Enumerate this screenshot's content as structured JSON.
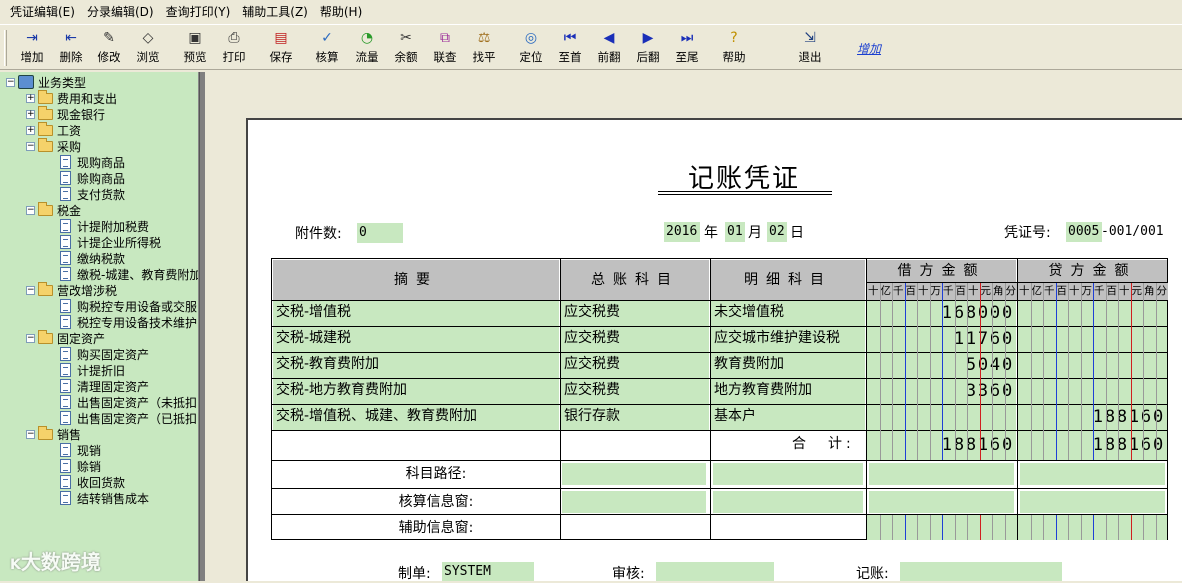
{
  "menu": [
    "凭证编辑(E)",
    "分录编辑(D)",
    "查询打印(Y)",
    "辅助工具(Z)",
    "帮助(H)"
  ],
  "toolbar": {
    "buttons": [
      {
        "label": "增加",
        "icon": "add-icon"
      },
      {
        "label": "删除",
        "icon": "delete-icon"
      },
      {
        "label": "修改",
        "icon": "edit-icon"
      },
      {
        "label": "浏览",
        "icon": "browse-icon"
      },
      {
        "label": "预览",
        "icon": "preview-icon"
      },
      {
        "label": "打印",
        "icon": "printer-icon"
      },
      {
        "label": "保存",
        "icon": "save-icon"
      },
      {
        "label": "核算",
        "icon": "audit-icon"
      },
      {
        "label": "流量",
        "icon": "flow-icon"
      },
      {
        "label": "余额",
        "icon": "balance-icon"
      },
      {
        "label": "联查",
        "icon": "link-query-icon"
      },
      {
        "label": "找平",
        "icon": "scale-icon"
      },
      {
        "label": "定位",
        "icon": "locate-icon"
      },
      {
        "label": "至首",
        "icon": "first-icon"
      },
      {
        "label": "前翻",
        "icon": "prev-icon"
      },
      {
        "label": "后翻",
        "icon": "next-icon"
      },
      {
        "label": "至尾",
        "icon": "last-icon"
      },
      {
        "label": "帮助",
        "icon": "help-icon"
      },
      {
        "label": "退出",
        "icon": "exit-icon"
      }
    ],
    "link": "增加"
  },
  "tree": {
    "root": "业务类型",
    "nodes": [
      {
        "label": "费用和支出",
        "type": "folder",
        "level": 1,
        "exp": "+"
      },
      {
        "label": "现金银行",
        "type": "folder",
        "level": 1,
        "exp": "+"
      },
      {
        "label": "工资",
        "type": "folder",
        "level": 1,
        "exp": "+"
      },
      {
        "label": "采购",
        "type": "folder",
        "level": 1,
        "exp": "-"
      },
      {
        "label": "现购商品",
        "type": "doc",
        "level": 2
      },
      {
        "label": "赊购商品",
        "type": "doc",
        "level": 2
      },
      {
        "label": "支付货款",
        "type": "doc",
        "level": 2
      },
      {
        "label": "税金",
        "type": "folder",
        "level": 1,
        "exp": "-"
      },
      {
        "label": "计提附加税费",
        "type": "doc",
        "level": 2
      },
      {
        "label": "计提企业所得税",
        "type": "doc",
        "level": 2
      },
      {
        "label": "缴纳税款",
        "type": "doc",
        "level": 2
      },
      {
        "label": "缴税-城建、教育费附加",
        "type": "doc",
        "level": 2
      },
      {
        "label": "营改增涉税",
        "type": "folder",
        "level": 1,
        "exp": "-"
      },
      {
        "label": "购税控专用设备或交服",
        "type": "doc",
        "level": 2
      },
      {
        "label": "税控专用设备技术维护",
        "type": "doc",
        "level": 2
      },
      {
        "label": "固定资产",
        "type": "folder",
        "level": 1,
        "exp": "-"
      },
      {
        "label": "购买固定资产",
        "type": "doc",
        "level": 2
      },
      {
        "label": "计提折旧",
        "type": "doc",
        "level": 2
      },
      {
        "label": "清理固定资产",
        "type": "doc",
        "level": 2
      },
      {
        "label": "出售固定资产（未抵扣",
        "type": "doc",
        "level": 2
      },
      {
        "label": "出售固定资产（已抵扣",
        "type": "doc",
        "level": 2
      },
      {
        "label": "销售",
        "type": "folder",
        "level": 1,
        "exp": "-"
      },
      {
        "label": "现销",
        "type": "doc",
        "level": 2
      },
      {
        "label": "赊销",
        "type": "doc",
        "level": 2
      },
      {
        "label": "收回货款",
        "type": "doc",
        "level": 2
      },
      {
        "label": "结转销售成本",
        "type": "doc",
        "level": 2
      }
    ]
  },
  "voucher": {
    "title": "记账凭证",
    "attach_label": "附件数:",
    "attach_value": "0",
    "year": "2016",
    "year_label": "年",
    "month": "01",
    "month_label": "月",
    "day": "02",
    "day_label": "日",
    "no_label": "凭证号:",
    "no_value": "0005",
    "no_suffix": "-001/001",
    "headers": {
      "summary": "摘要",
      "ledger": "总账科目",
      "detail": "明细科目",
      "debit": "借方金额",
      "credit": "贷方金额"
    },
    "digit_units": [
      "十",
      "亿",
      "千",
      "百",
      "十",
      "万",
      "千",
      "百",
      "十",
      "元",
      "角",
      "分"
    ],
    "rows": [
      {
        "summary": "交税-增值税",
        "ledger": "应交税费",
        "detail": "未交增值税",
        "debit": "168000",
        "credit": ""
      },
      {
        "summary": "交税-城建税",
        "ledger": "应交税费",
        "detail": "应交城市维护建设税",
        "debit": "11760",
        "credit": ""
      },
      {
        "summary": "交税-教育费附加",
        "ledger": "应交税费",
        "detail": "教育费附加",
        "debit": "5040",
        "credit": ""
      },
      {
        "summary": "交税-地方教育费附加",
        "ledger": "应交税费",
        "detail": "地方教育费附加",
        "debit": "3360",
        "credit": ""
      },
      {
        "summary": "交税-增值税、城建、教育费附加",
        "ledger": "银行存款",
        "detail": "基本户",
        "debit": "",
        "credit": "188160"
      }
    ],
    "total_label": "合　计:",
    "total_debit": "188160",
    "total_credit": "188160",
    "path_label": "科目路径:",
    "calc_label": "核算信息窗:",
    "aux_label": "辅助信息窗:",
    "maker_label": "制单:",
    "maker_value": "SYSTEM",
    "checker_label": "审核:",
    "checker_value": "",
    "poster_label": "记账:",
    "poster_value": ""
  },
  "watermark": "大数跨境",
  "colors": {
    "field": "#C8E8C0",
    "header": "#C0C0C0",
    "blue_line": "#1f3fd6",
    "red_line": "#d02020"
  }
}
